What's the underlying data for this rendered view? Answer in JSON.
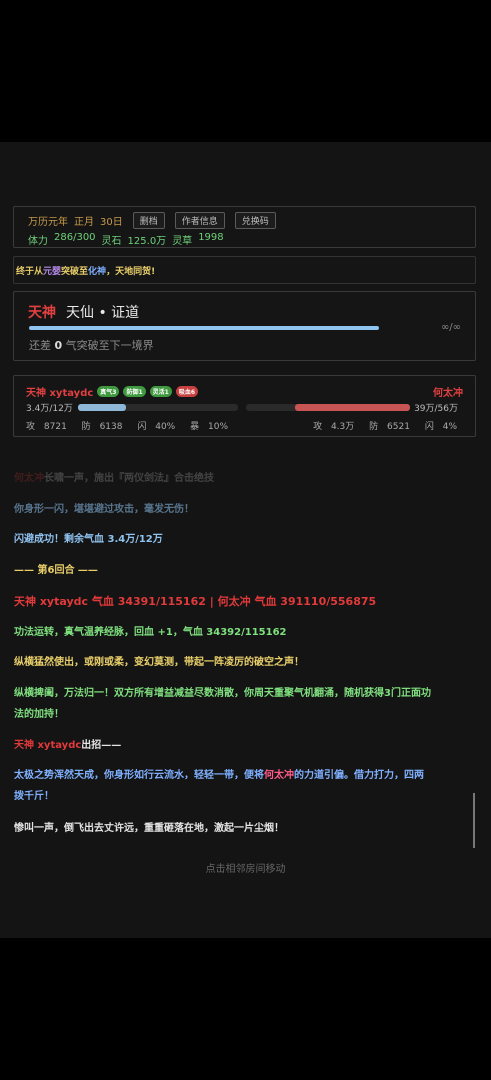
{
  "status": {
    "era": "万历元年",
    "month": "正月",
    "day": "30日",
    "btn_feedback": "删档",
    "btn_author": "作者信息",
    "btn_redeem": "兑换码",
    "stamina_label": "体力",
    "stamina_value": "286/300",
    "stone_label": "灵石",
    "stone_value": "125.0万",
    "herb_label": "灵草",
    "herb_value": "1998"
  },
  "announce": {
    "p1": "终于从",
    "p2": "元婴",
    "p3": "突破至",
    "p4": "化神",
    "p5": "，天地同贺!"
  },
  "realm": {
    "god": "天神",
    "level": "天仙 • 证道",
    "inf": "∞/∞",
    "sub_pre": "还差",
    "sub_num": "0",
    "sub_post": "气突破至下一境界"
  },
  "battle": {
    "p1_name": "天神 xytaydc",
    "tags": [
      "真气3",
      "防御1",
      "灵活1",
      "吸血6"
    ],
    "p2_name": "何太冲",
    "p1_hp": "3.4万/12万",
    "p1_ratio": 0.3,
    "p2_hp": "39万/56万",
    "p2_ratio": 0.7,
    "p1_atk_l": "攻",
    "p1_atk": "8721",
    "p1_def_l": "防",
    "p1_def": "6138",
    "p1_dodge_l": "闪",
    "p1_dodge": "40%",
    "p1_crit_l": "暴",
    "p1_crit": "10%",
    "p2_atk_l": "攻",
    "p2_atk": "4.3万",
    "p2_def_l": "防",
    "p2_def": "6521",
    "p2_dodge_l": "闪",
    "p2_dodge": "4%"
  },
  "log": {
    "l0a": "何太冲",
    "l0b": "长啸一声，施出『两仪剑法』合击绝技",
    "l1": "你身形一闪，堪堪避过攻击，毫发无伤！",
    "l2": "闪避成功！剩余气血 3.4万/12万",
    "l3": "—— 第6回合 ——",
    "l4a": "天神 xytaydc",
    "l4b": "气血 34391/115162",
    "l4c": "|",
    "l4d": "何太冲",
    "l4e": "气血 391110/556875",
    "l5": "功法运转，真气温养经脉，回血 +1，气血 34392/115162",
    "l6": "纵横猛然使出，或刚或柔，变幻莫测，带起一阵凌厉的破空之声！",
    "l7a": "纵横捭阖，万法归一！双方所有增益减益尽数消散，你周天重聚气机翻涌，随机获得3门正面功",
    "l7b": "法的加持！",
    "l8a": "天神 xytaydc",
    "l8b": "出招——",
    "l9a": "太极之势浑然天成，你身形如行云流水，轻轻一带，便将",
    "l9b": "何太冲",
    "l9c": "的力道引偏。借力打力，四两",
    "l9d": "拨千斤！",
    "l10": "惨叫一声，倒飞出去丈许远，重重砸落在地，激起一片尘烟！"
  },
  "hint": "点击相邻房间移动"
}
